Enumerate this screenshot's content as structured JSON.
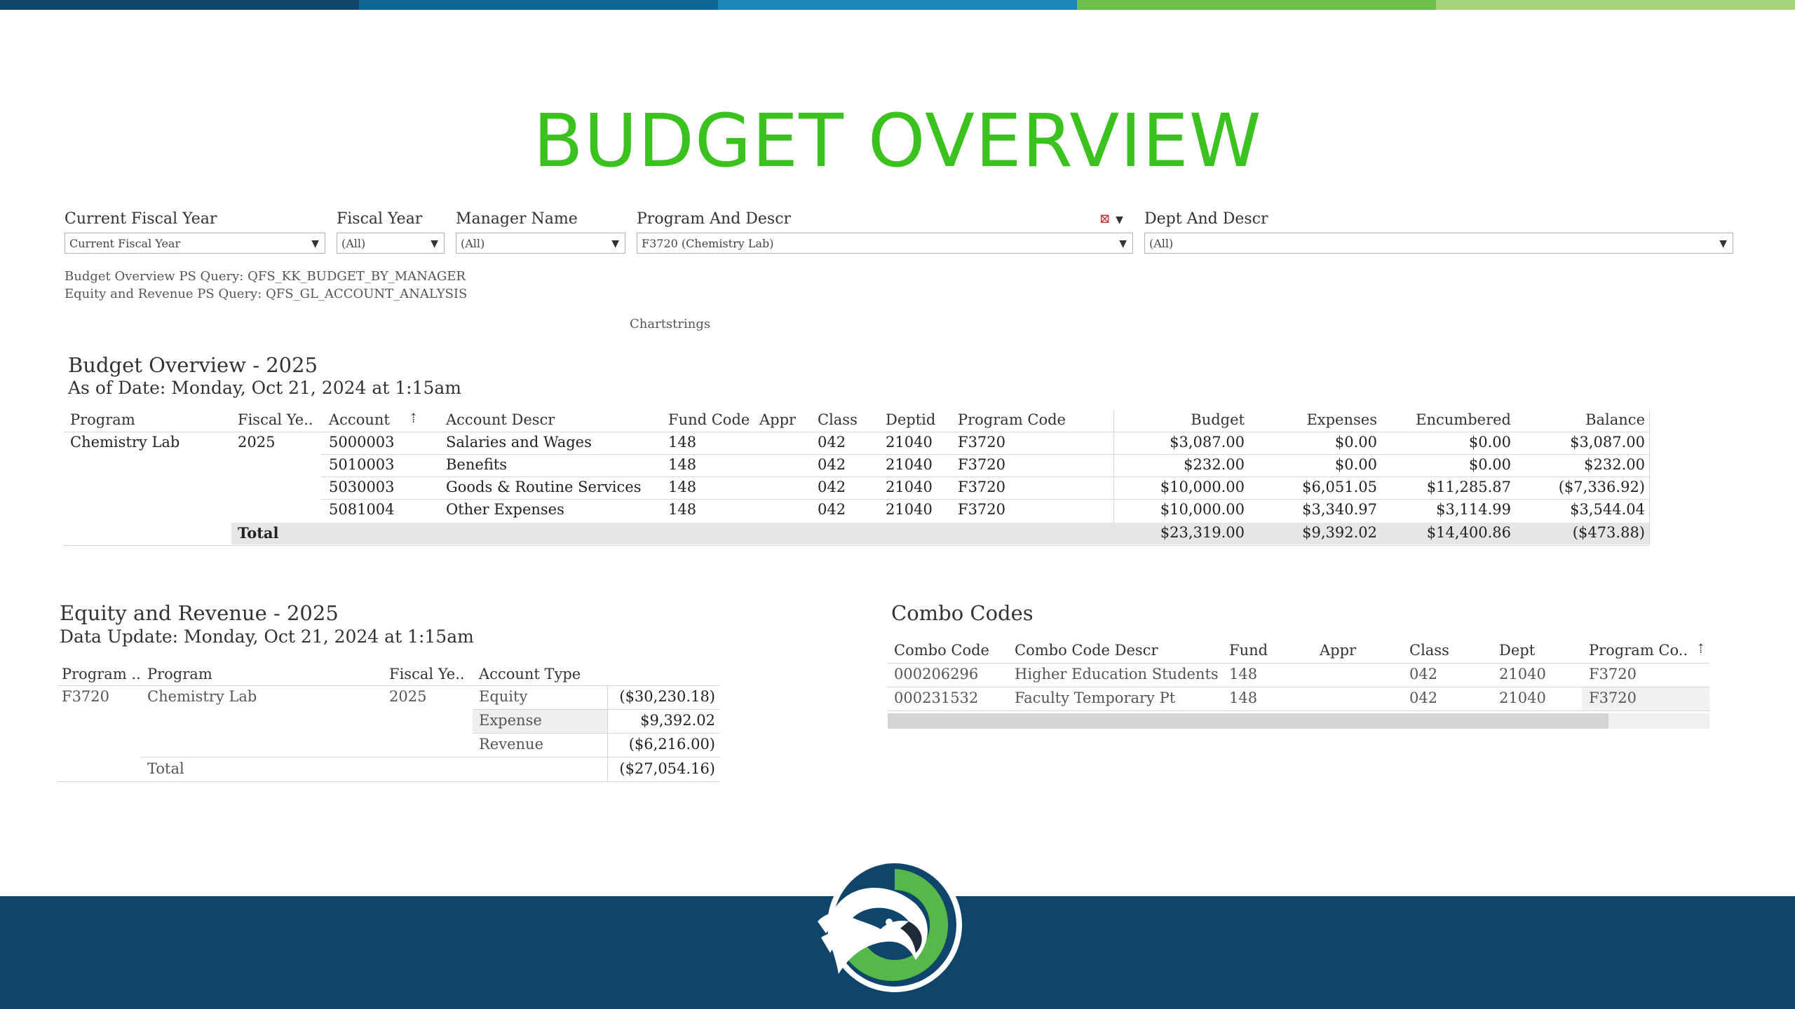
{
  "top_bar_colors": [
    "#10456b",
    "#0f6694",
    "#1f86b8",
    "#6cc04a",
    "#a6d37a"
  ],
  "title": "BUDGET OVERVIEW",
  "filters": [
    {
      "label": "Current Fiscal Year",
      "value": "Current Fiscal Year"
    },
    {
      "label": "Fiscal Year",
      "value": "(All)"
    },
    {
      "label": "Manager Name",
      "value": "(All)"
    },
    {
      "label": "Program And Descr",
      "value": "F3720 (Chemistry Lab)"
    },
    {
      "label": "Dept And Descr",
      "value": "(All)"
    }
  ],
  "queries": {
    "budget": "Budget Overview PS Query: QFS_KK_BUDGET_BY_MANAGER",
    "equity": "Equity and Revenue PS Query: QFS_GL_ACCOUNT_ANALYSIS"
  },
  "chartstrings_label": "Chartstrings",
  "budget": {
    "title": "Budget Overview - 2025",
    "asof": "As of Date: Monday, Oct 21, 2024 at 1:15am",
    "headers": [
      "Program",
      "Fiscal Ye..",
      "Account",
      "Account Descr",
      "Fund Code",
      "Appr",
      "Class",
      "Deptid",
      "Program Code",
      "Budget",
      "Expenses",
      "Encumbered",
      "Balance"
    ],
    "program": "Chemistry Lab",
    "fiscal_year": "2025",
    "rows": [
      [
        "5000003",
        "Salaries and Wages",
        "148",
        "",
        "042",
        "21040",
        "F3720",
        "$3,087.00",
        "$0.00",
        "$0.00",
        "$3,087.00"
      ],
      [
        "5010003",
        "Benefits",
        "148",
        "",
        "042",
        "21040",
        "F3720",
        "$232.00",
        "$0.00",
        "$0.00",
        "$232.00"
      ],
      [
        "5030003",
        "Goods & Routine Services",
        "148",
        "",
        "042",
        "21040",
        "F3720",
        "$10,000.00",
        "$6,051.05",
        "$11,285.87",
        "($7,336.92)"
      ],
      [
        "5081004",
        "Other Expenses",
        "148",
        "",
        "042",
        "21040",
        "F3720",
        "$10,000.00",
        "$3,340.97",
        "$3,114.99",
        "$3,544.04"
      ]
    ],
    "total_label": "Total",
    "total": [
      "$23,319.00",
      "$9,392.02",
      "$14,400.86",
      "($473.88)"
    ]
  },
  "equity": {
    "title": "Equity and Revenue - 2025",
    "update": "Data Update: Monday, Oct 21, 2024 at 1:15am",
    "headers": [
      "Program ..",
      "Program",
      "Fiscal Ye..",
      "Account Type"
    ],
    "program_code": "F3720",
    "program": "Chemistry Lab",
    "fiscal_year": "2025",
    "rows": [
      {
        "type": "Equity",
        "value": "($30,230.18)"
      },
      {
        "type": "Expense",
        "value": "$9,392.02"
      },
      {
        "type": "Revenue",
        "value": "($6,216.00)"
      }
    ],
    "total_label": "Total",
    "total": "($27,054.16)"
  },
  "combo": {
    "title": "Combo Codes",
    "headers": [
      "Combo Code",
      "Combo Code Descr",
      "Fund",
      "Appr",
      "Class",
      "Dept",
      "Program Co.."
    ],
    "rows": [
      [
        "000206296",
        "Higher Education Students",
        "148",
        "",
        "042",
        "21040",
        "F3720"
      ],
      [
        "000231532",
        "Faculty Temporary Pt",
        "148",
        "",
        "042",
        "21040",
        "F3720"
      ]
    ]
  }
}
